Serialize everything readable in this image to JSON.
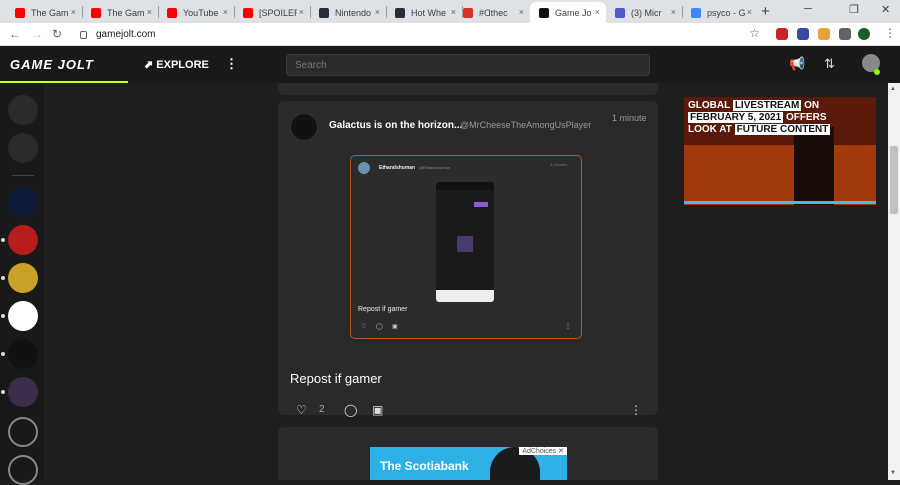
{
  "browser": {
    "tabs": [
      {
        "title": "The Gam",
        "color": "#ff0000"
      },
      {
        "title": "The Gam",
        "color": "#ff0000"
      },
      {
        "title": "YouTube",
        "color": "#ff0000"
      },
      {
        "title": "[SPOILER",
        "color": "#ff0000"
      },
      {
        "title": "Nintendo",
        "color": "#232f3e"
      },
      {
        "title": "Hot Whe",
        "color": "#232f3e"
      },
      {
        "title": "#Ɑthec",
        "color": "#d93025"
      },
      {
        "title": "Game Jo",
        "color": "#111111"
      },
      {
        "title": "(3) Micr",
        "color": "#5059c9"
      },
      {
        "title": "psyco - G",
        "color": "#4285f4"
      }
    ],
    "url": "gamejolt.com",
    "new_tab": "+",
    "tab_close": "×"
  },
  "gj": {
    "logo": "GAME JOLT",
    "explore": "EXPLORE",
    "search_placeholder": "Search",
    "accent": "#ccff00"
  },
  "post": {
    "author": "Galactus is on the horizon...",
    "handle": "@MrCheeseTheAmongUsPlayer",
    "time": "1 minute",
    "text": "Repost if gamer",
    "likes": "2",
    "embed": {
      "author": "Ethandshuman",
      "handle": "@Ethandshuman",
      "time": "3 minutes",
      "caption": "Repost if gamer"
    }
  },
  "ads": {
    "banner_line1": "GLOBAL",
    "banner_hl1": "LIVESTREAM",
    "banner_line1b": "ON",
    "banner_hl2": "FEBRUARY 5, 2021",
    "banner_line2": "OFFERS",
    "banner_line3": "LOOK AT",
    "banner_hl3": "FUTURE CONTENT",
    "ad2_text": "The Scotiabank",
    "ad2_choices": "AdChoices ✕"
  }
}
